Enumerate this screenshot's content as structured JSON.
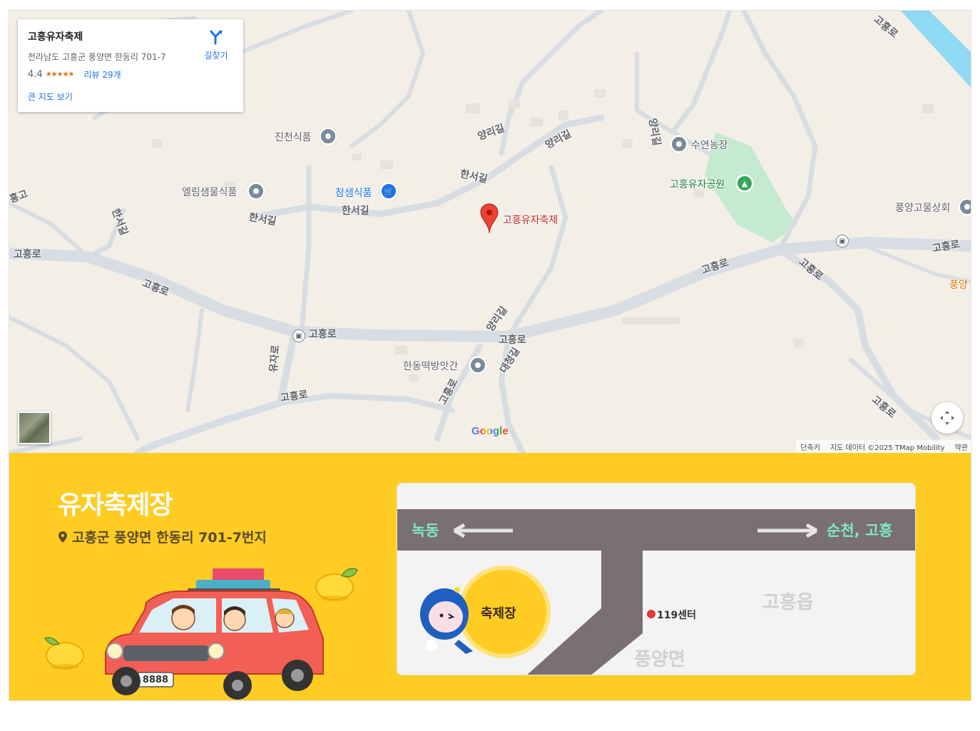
{
  "place_card": {
    "name": "고흥유자축제",
    "address": "전라남도 고흥군 풍양면 한동리 701-7",
    "rating": "4.4",
    "stars": "★★★★★",
    "reviews": "리뷰 29개",
    "big_map_link": "큰 지도 보기",
    "directions_label": "길찾기"
  },
  "map": {
    "poi": {
      "jincheon": "진천식품",
      "ellim": "엘림샘물식품",
      "chamsaem": "참샘식품",
      "festival_marker": "고흥유자축제",
      "suyeon": "수연농장",
      "park": "고흥유자공원",
      "pungyang_store": "풍양고물상회",
      "handong": "한동떡방앗간",
      "pungyang_partial": "풍양"
    },
    "roads": {
      "goheungro": "고흥로",
      "hanseogil": "한서길",
      "yangrigil": "양리길",
      "yujaro": "유자로",
      "daecheonggil": "대청길",
      "partial_left": "흥고"
    },
    "google": "Google",
    "attribution": {
      "shortcuts": "단축키",
      "data": "지도 데이터 ©2025 TMap Mobility",
      "terms": "약관"
    },
    "colors": {
      "land": "#f3efe6",
      "road": "#d8dde3",
      "park": "#c4eacf",
      "water": "#8fd9f2",
      "marker": "#ea4335"
    }
  },
  "festival": {
    "title": "유자축제장",
    "address": "고흥군 풍양면 한동리 701-7번지",
    "plate": "8888",
    "mini_map": {
      "left_dest": "녹동",
      "right_dest": "순천, 고흥",
      "venue": "축제장",
      "center_119": "119센터",
      "town1": "고흥읍",
      "town2": "풍양면"
    },
    "colors": {
      "background": "#ffcc24",
      "road": "#7a6f73",
      "dest_text": "#7ee8c8"
    }
  }
}
